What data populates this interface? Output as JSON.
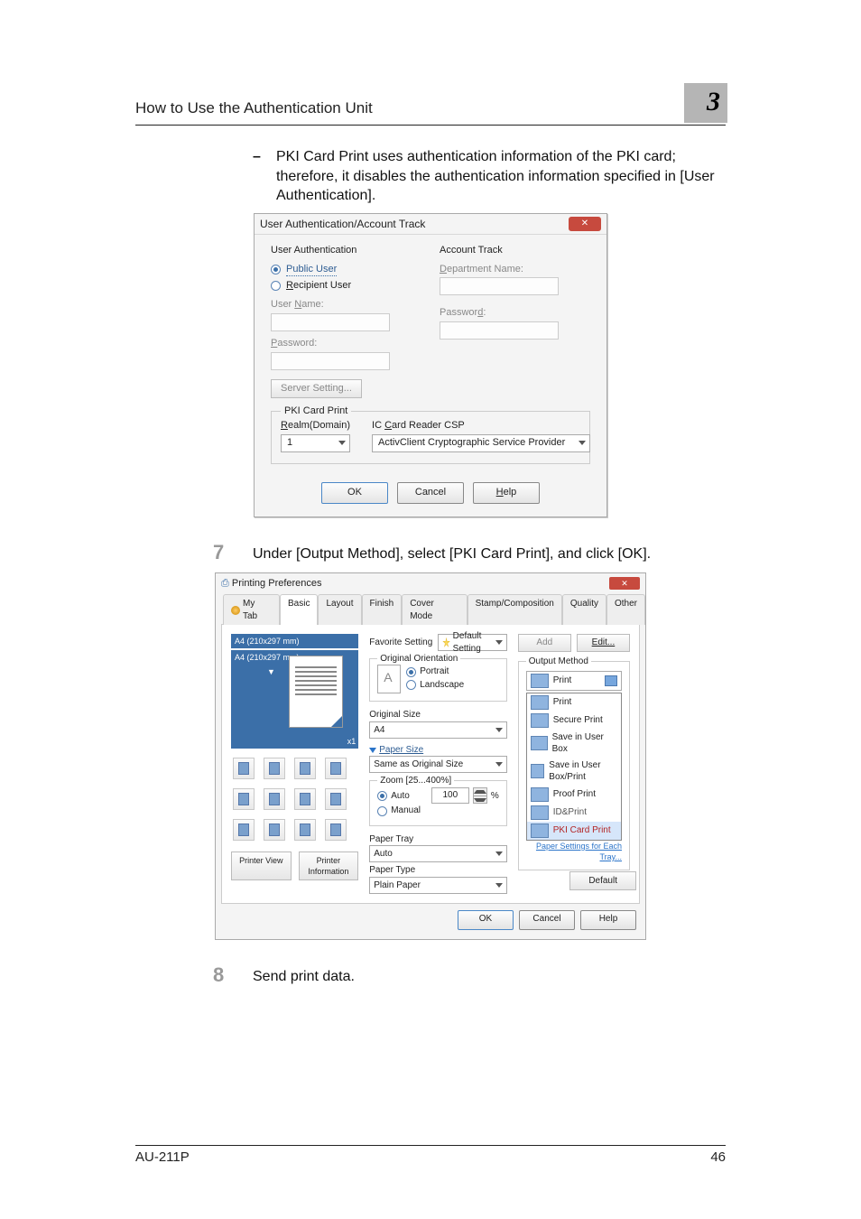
{
  "header": {
    "title": "How to Use the Authentication Unit",
    "section_number": "3"
  },
  "bullet": {
    "text": "PKI Card Print uses authentication information of the PKI card; therefore, it disables the authentication information specified in [User Authentication]."
  },
  "dialog1": {
    "title": "User Authentication/Account Track",
    "user_auth_label": "User Authentication",
    "public_user": "Public User",
    "recipient_user": "Recipient User",
    "user_name_label": "User Name:",
    "password_label": "Password:",
    "server_setting_btn": "Server Setting...",
    "account_track_label": "Account Track",
    "dept_name_label": "Department Name:",
    "at_password_label": "Password:",
    "pki_legend": "PKI Card Print",
    "realm_label": "Realm(Domain)",
    "realm_value": "1",
    "csp_label": "IC Card Reader CSP",
    "csp_value": "ActivClient Cryptographic Service Provider",
    "ok": "OK",
    "cancel": "Cancel",
    "help": "Help"
  },
  "step7": {
    "num": "7",
    "text": "Under [Output Method], select [PKI Card Print], and click [OK]."
  },
  "dialog2": {
    "title": "Printing Preferences",
    "tabs": {
      "my": "My Tab",
      "basic": "Basic",
      "layout": "Layout",
      "finish": "Finish",
      "cover": "Cover Mode",
      "stamp": "Stamp/Composition",
      "quality": "Quality",
      "other": "Other"
    },
    "preview": {
      "size1": "A4 (210x297 mm)",
      "size2": "A4 (210x297 mm)",
      "mult": "x1",
      "printer_view": "Printer View",
      "printer_info": "Printer Information"
    },
    "mid": {
      "fav_label": "Favorite Setting",
      "fav_value": "Default Setting",
      "orig_orient_legend": "Original Orientation",
      "portrait": "Portrait",
      "landscape": "Landscape",
      "orig_size_label": "Original Size",
      "orig_size_value": "A4",
      "paper_size_link": "Paper Size",
      "paper_size_value": "Same as Original Size",
      "zoom_legend": "Zoom [25...400%]",
      "auto": "Auto",
      "manual": "Manual",
      "zoom_value": "100",
      "percent": "%",
      "paper_tray_label": "Paper Tray",
      "paper_tray_value": "Auto",
      "paper_type_label": "Paper Type",
      "paper_type_value": "Plain Paper"
    },
    "right": {
      "add": "Add",
      "edit": "Edit...",
      "out_legend": "Output Method",
      "out_value": "Print",
      "items": {
        "print": "Print",
        "secure": "Secure Print",
        "userbox": "Save in User Box",
        "userboxprint": "Save in User Box/Print",
        "proof": "Proof Print",
        "idprint": "ID&Print",
        "pki": "PKI Card Print"
      },
      "lock_tray": "Paper Settings for Each Tray...",
      "default": "Default"
    },
    "ok": "OK",
    "cancel": "Cancel",
    "help": "Help"
  },
  "step8": {
    "num": "8",
    "text": "Send print data."
  },
  "footer": {
    "left": "AU-211P",
    "right": "46"
  }
}
